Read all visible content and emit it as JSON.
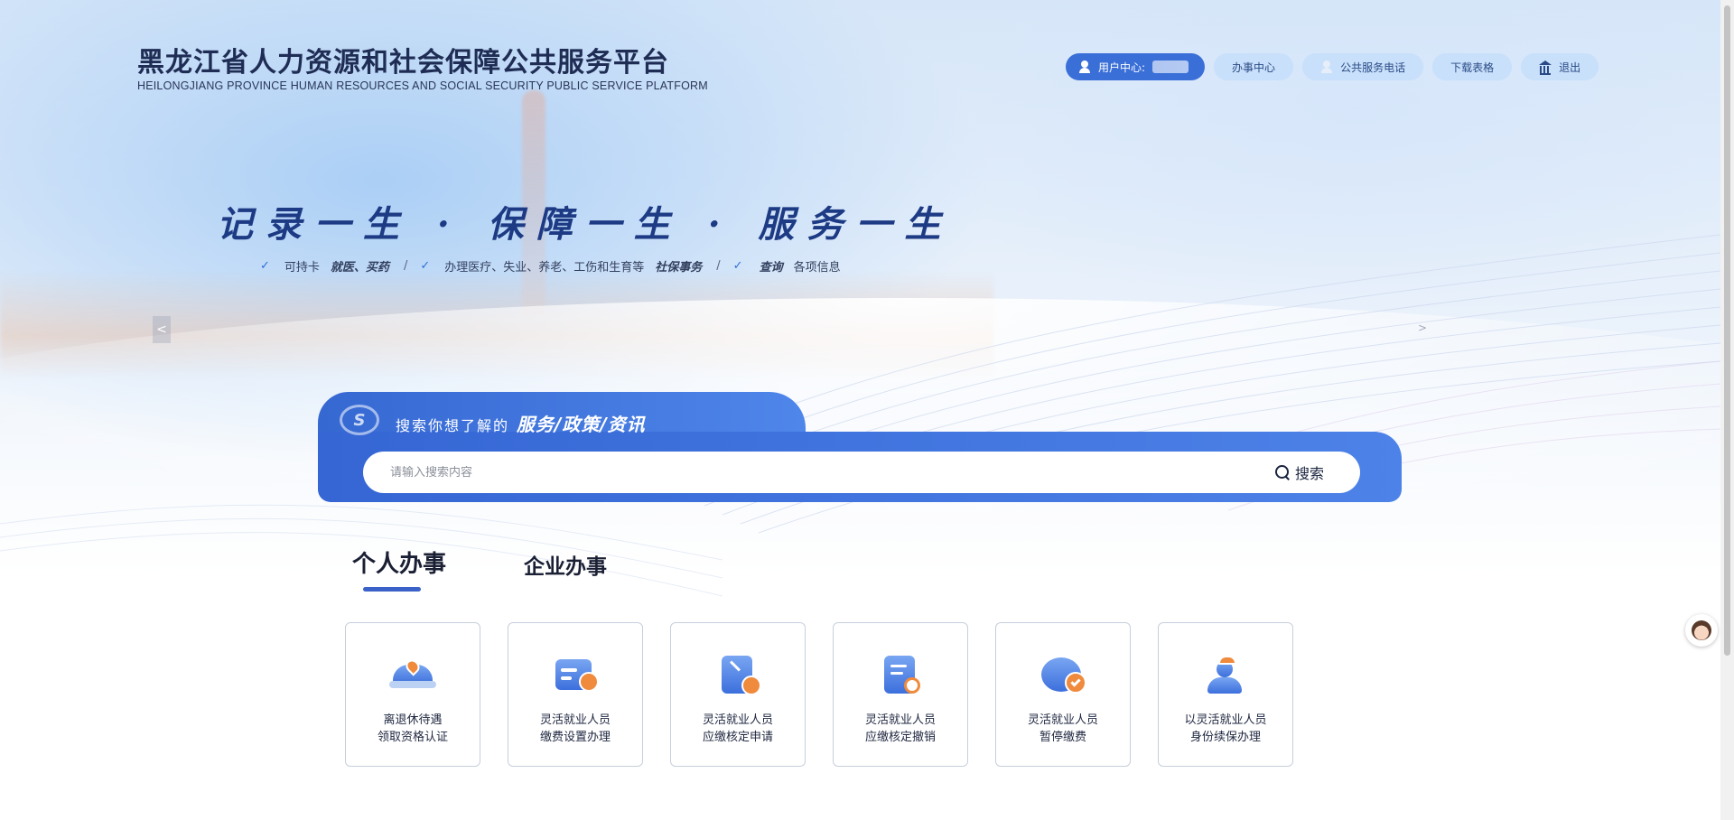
{
  "header": {
    "title": "黑龙江省人力资源和社会保障公共服务平台",
    "subtitle": "HEILONGJIANG PROVINCE HUMAN RESOURCES AND SOCIAL SECURITY PUBLIC SERVICE PLATFORM"
  },
  "nav": {
    "user_center": "用户中心:",
    "service_center": "办事中心",
    "public_phone": "公共服务电话",
    "download_forms": "下载表格",
    "logout": "退出"
  },
  "banner": {
    "slogan": "记录一生 · 保障一生 · 服务一生",
    "features": [
      {
        "pre": "可持卡",
        "bold": "就医、买药",
        "post": ""
      },
      {
        "pre": "办理医疗、失业、养老、工伤和生育等",
        "bold": "社保事务",
        "post": ""
      },
      {
        "pre": "",
        "bold": "查询",
        "post": "各项信息"
      }
    ],
    "prev": "<",
    "next": ">"
  },
  "search": {
    "logo": "S",
    "tip": "搜索你想了解的",
    "tip_bold": "服务/政策/资讯",
    "placeholder": "请输入搜索内容",
    "button": "搜索"
  },
  "tabs": {
    "personal": "个人办事",
    "enterprise": "企业办事"
  },
  "cards": [
    {
      "line1": "离退休待遇",
      "line2": "领取资格认证"
    },
    {
      "line1": "灵活就业人员",
      "line2": "缴费设置办理"
    },
    {
      "line1": "灵活就业人员",
      "line2": "应缴核定申请"
    },
    {
      "line1": "灵活就业人员",
      "line2": "应缴核定撤销"
    },
    {
      "line1": "灵活就业人员",
      "line2": "暂停缴费"
    },
    {
      "line1": "以灵活就业人员",
      "line2": "身份续保办理"
    }
  ],
  "colors": {
    "primary": "#3a6fd8",
    "accent_orange": "#f08a3c",
    "title": "#1f2d55"
  }
}
